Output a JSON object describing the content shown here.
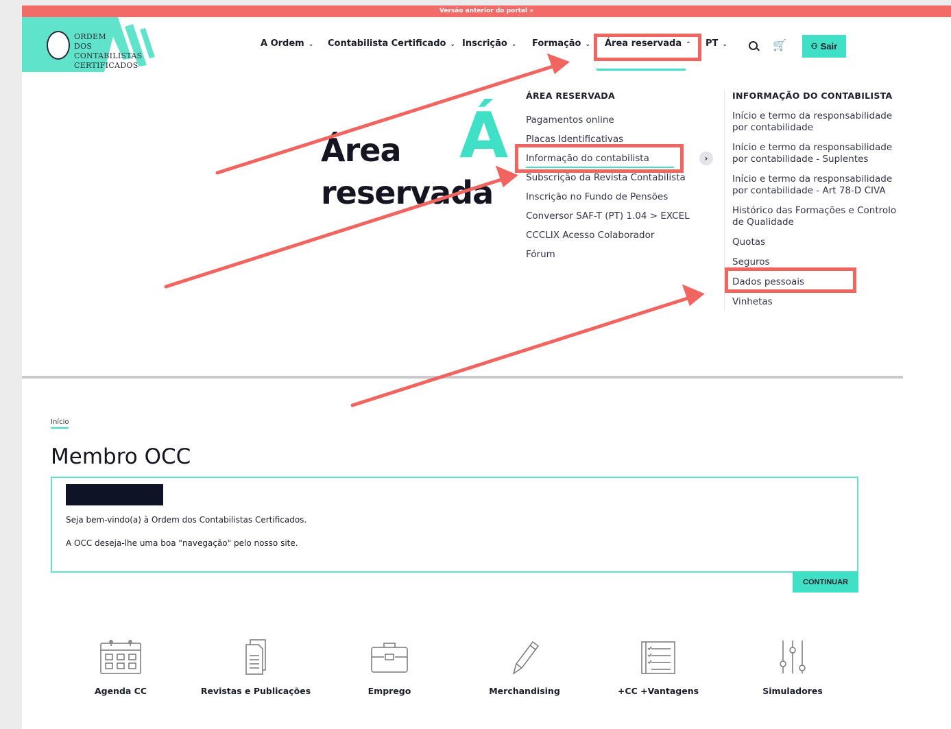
{
  "topbar": {
    "text": "Versão anterior do portal »"
  },
  "logo": {
    "line1": "ORDEM",
    "line2": "DOS CONTABILISTAS",
    "line3": "CERTIFICADOS"
  },
  "nav": {
    "items": [
      {
        "label": "A Ordem"
      },
      {
        "label": "Contabilista Certificado"
      },
      {
        "label": "Inscrição"
      },
      {
        "label": "Formação"
      },
      {
        "label": "Área reservada"
      }
    ],
    "language": "PT",
    "logout_label": "Sair"
  },
  "hero": {
    "line1": "Área",
    "line2": "reservada",
    "accent": "Á"
  },
  "dropdown": {
    "col1_title": "ÁREA RESERVADA",
    "col1_items": [
      "Pagamentos online",
      "Placas Identificativas",
      "Informação do contabilista",
      "Subscrição da Revista Contabilista",
      "Inscrição no Fundo de Pensões",
      "Conversor SAF-T (PT) 1.04 > EXCEL",
      "CCCLIX Acesso Colaborador",
      "Fórum"
    ],
    "col2_title": "INFORMAÇÃO DO CONTABILISTA",
    "col2_items": [
      "Início e termo da responsabilidade por contabilidade",
      "Início e termo da responsabilidade por contabilidade - Suplentes",
      "Início e termo da responsabilidade por contabilidade - Art 78-D CIVA",
      "Histórico das Formações e Controlo de Qualidade",
      "Quotas",
      "Seguros",
      "Dados pessoais",
      "Vinhetas"
    ]
  },
  "breadcrumb": "Início",
  "page_title": "Membro OCC",
  "welcome": {
    "line1": "Seja bem-vindo(a) à Ordem dos Contabilistas Certificados.",
    "line2": "A OCC deseja-lhe uma boa \"navegação\" pelo nosso site."
  },
  "continue_label": "CONTINUAR",
  "shortcuts": [
    {
      "label": "Agenda CC",
      "icon": "calendar-icon"
    },
    {
      "label": "Revistas e Publicações",
      "icon": "document-icon"
    },
    {
      "label": "Emprego",
      "icon": "briefcase-icon"
    },
    {
      "label": "Merchandising",
      "icon": "pencil-icon"
    },
    {
      "label": "+CC +Vantagens",
      "icon": "checklist-icon"
    },
    {
      "label": "Simuladores",
      "icon": "sliders-icon"
    }
  ],
  "colors": {
    "accent": "#3fe0c5",
    "annotation": "#f06560",
    "topbar": "#f26b68"
  }
}
